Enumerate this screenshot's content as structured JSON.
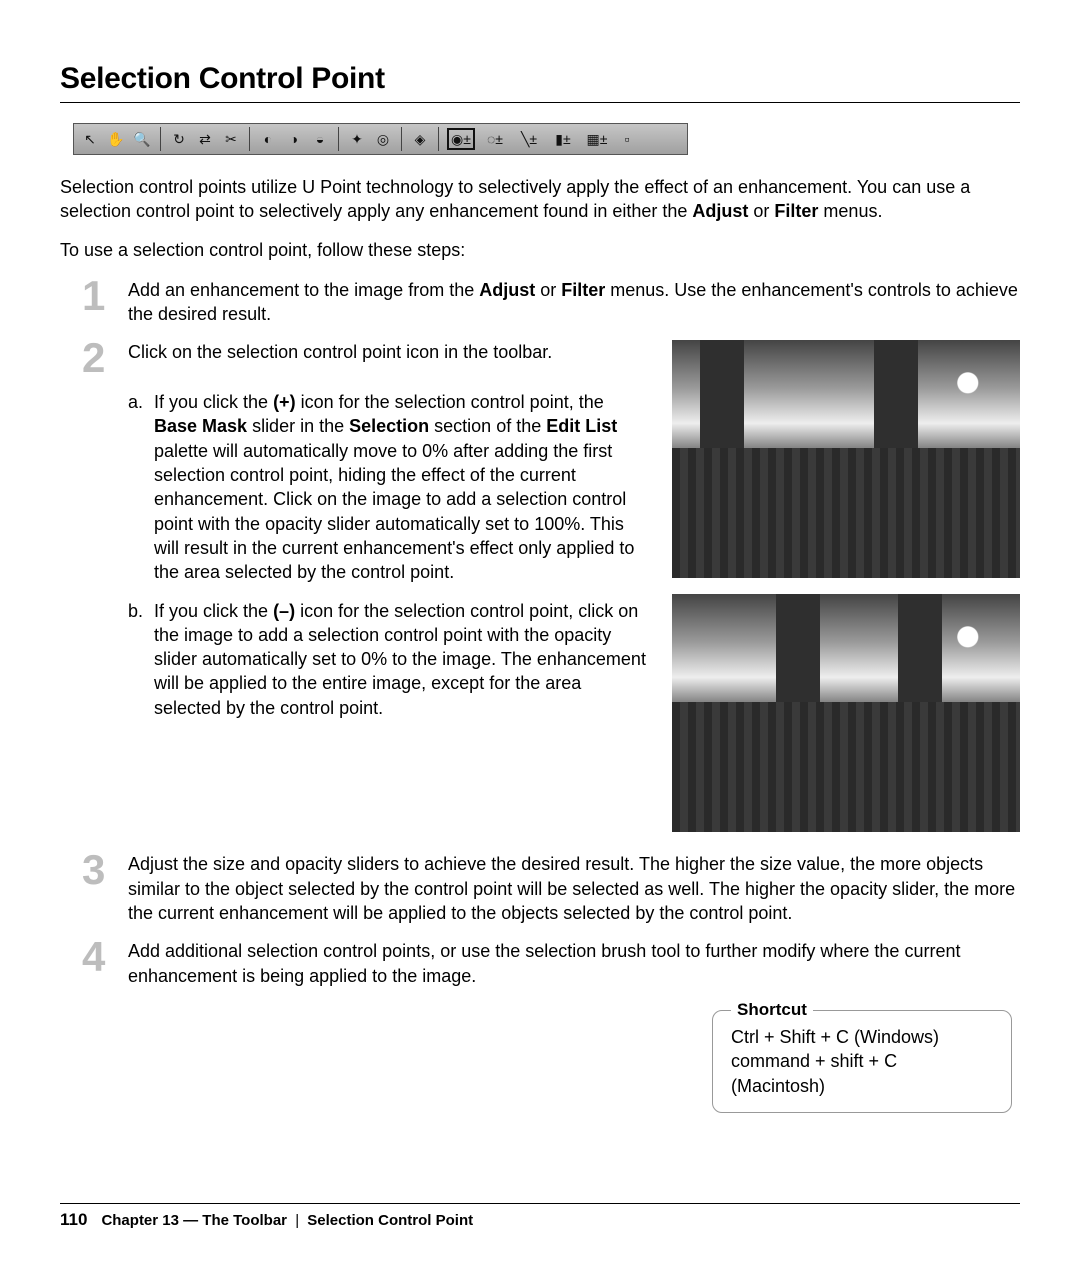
{
  "title": "Selection Control Point",
  "toolbar": {
    "tools": [
      {
        "name": "pointer-icon",
        "glyph": "↖"
      },
      {
        "name": "hand-icon",
        "glyph": "✋"
      },
      {
        "name": "zoom-icon",
        "glyph": "🔍"
      },
      {
        "name": "rotate-icon",
        "glyph": "↻"
      },
      {
        "name": "straighten-icon",
        "glyph": "⇄"
      },
      {
        "name": "crop-icon",
        "glyph": "✂"
      },
      {
        "name": "black-point-icon",
        "glyph": "◐"
      },
      {
        "name": "neutral-point-icon",
        "glyph": "◑"
      },
      {
        "name": "white-point-icon",
        "glyph": "◒"
      },
      {
        "name": "auto-retouch-icon",
        "glyph": "✦"
      },
      {
        "name": "redeye-icon",
        "glyph": "◎"
      },
      {
        "name": "color-point-icon",
        "glyph": "◈"
      },
      {
        "name": "selection-control-icon",
        "glyph": "◉±",
        "selected": true
      },
      {
        "name": "lasso-icon",
        "glyph": "◌±"
      },
      {
        "name": "brush-icon",
        "glyph": "╲±"
      },
      {
        "name": "gradient-icon",
        "glyph": "▮±"
      },
      {
        "name": "fill-icon",
        "glyph": "▦±"
      },
      {
        "name": "mask-icon",
        "glyph": "▫"
      }
    ]
  },
  "intro": {
    "p1_pre": "Selection control points utilize U Point technology to selectively apply the effect of an enhancement. You can use a selection control point to selectively apply any enhancement found in either the ",
    "p1_b1": "Adjust",
    "p1_mid": " or ",
    "p1_b2": "Filter",
    "p1_post": " menus.",
    "p2": "To use a selection control point, follow these steps:"
  },
  "steps": {
    "s1": {
      "num": "1",
      "pre": "Add an enhancement to the image from the ",
      "b1": "Adjust",
      "mid": " or ",
      "b2": "Filter",
      "post": " menus. Use the enhancement's controls to achieve the desired result."
    },
    "s2": {
      "num": "2",
      "text": "Click on the selection control point icon in the toolbar.",
      "a_letter": "a.",
      "a": {
        "t1": "If you click the ",
        "b1": "(+)",
        "t2": " icon for the selection control point, the ",
        "b2": "Base Mask",
        "t3": " slider in the ",
        "b3": "Selection",
        "t4": " section of the ",
        "b4": "Edit List",
        "t5": " palette will automatically move to 0% after adding the first selection control point, hiding the effect of the current enhancement. Click on the image to add a selection control point with the opacity slider automatically set to 100%. This will result in the current enhancement's effect only applied to the area selected by the control point."
      },
      "b_letter": "b.",
      "b": {
        "t1": "If you click the ",
        "b1": "(–)",
        "t2": " icon for the selection control point, click on the image to add a selection control point with the opacity slider automatically set to 0% to the image. The enhancement will be applied to the entire image, except for the area selected by the control point."
      }
    },
    "s3": {
      "num": "3",
      "text": "Adjust the size and opacity sliders to achieve the desired result. The higher the size value, the more objects similar to the object selected by the control point will be selected as well. The higher the opacity slider, the more the current enhancement will be applied to the objects selected by the control point."
    },
    "s4": {
      "num": "4",
      "text": "Add additional selection control points, or use the selection brush tool to further modify where the current enhancement is being applied to the image."
    }
  },
  "shortcut": {
    "label": "Shortcut",
    "win": "Ctrl + Shift + C (Windows)",
    "mac": "command + shift + C (Macintosh)"
  },
  "footer": {
    "page": "110",
    "chapter": "Chapter 13 — The Toolbar",
    "section": "Selection Control Point"
  }
}
